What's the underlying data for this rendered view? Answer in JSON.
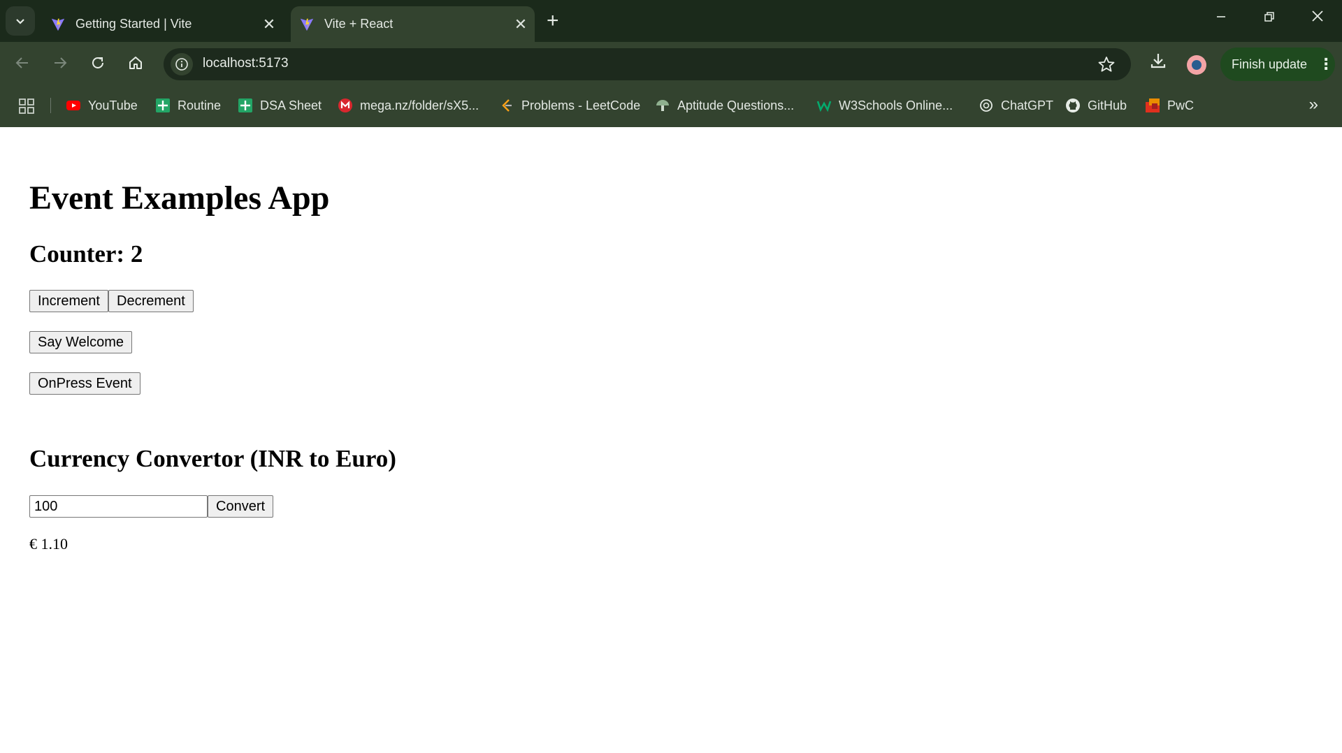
{
  "browser": {
    "tabs": [
      {
        "title": "Getting Started | Vite",
        "active": false
      },
      {
        "title": "Vite + React",
        "active": true
      }
    ],
    "url": "localhost:5173",
    "finish_update_label": "Finish update",
    "bookmarks": [
      {
        "label": "YouTube",
        "icon": "youtube-icon",
        "color": "#ff0000"
      },
      {
        "label": "Routine",
        "icon": "sheets-icon",
        "color": "#23a566"
      },
      {
        "label": "DSA Sheet",
        "icon": "sheets-icon",
        "color": "#23a566"
      },
      {
        "label": "mega.nz/folder/sX5...",
        "icon": "mega-icon",
        "color": "#d9272e"
      },
      {
        "label": "Problems - LeetCode",
        "icon": "leetcode-icon",
        "color": "#ffa116"
      },
      {
        "label": "Aptitude Questions...",
        "icon": "mushroom-icon",
        "color": "#8fb08f"
      },
      {
        "label": "W3Schools Online...",
        "icon": "w3schools-icon",
        "color": "#04aa6d"
      },
      {
        "label": "ChatGPT",
        "icon": "chatgpt-icon",
        "color": "#e6ece6"
      },
      {
        "label": "GitHub",
        "icon": "github-icon",
        "color": "#e6ece6"
      },
      {
        "label": "PwC",
        "icon": "pwc-icon",
        "color": "#e0301e"
      }
    ]
  },
  "app": {
    "title": "Event Examples App",
    "counter_text": "Counter: 2",
    "increment_label": "Increment",
    "decrement_label": "Decrement",
    "welcome_label": "Say Welcome",
    "onpress_label": "OnPress Event",
    "currency_title": "Currency Convertor (INR to Euro)",
    "amount_value": "100",
    "convert_label": "Convert",
    "result_text": "€ 1.10"
  }
}
